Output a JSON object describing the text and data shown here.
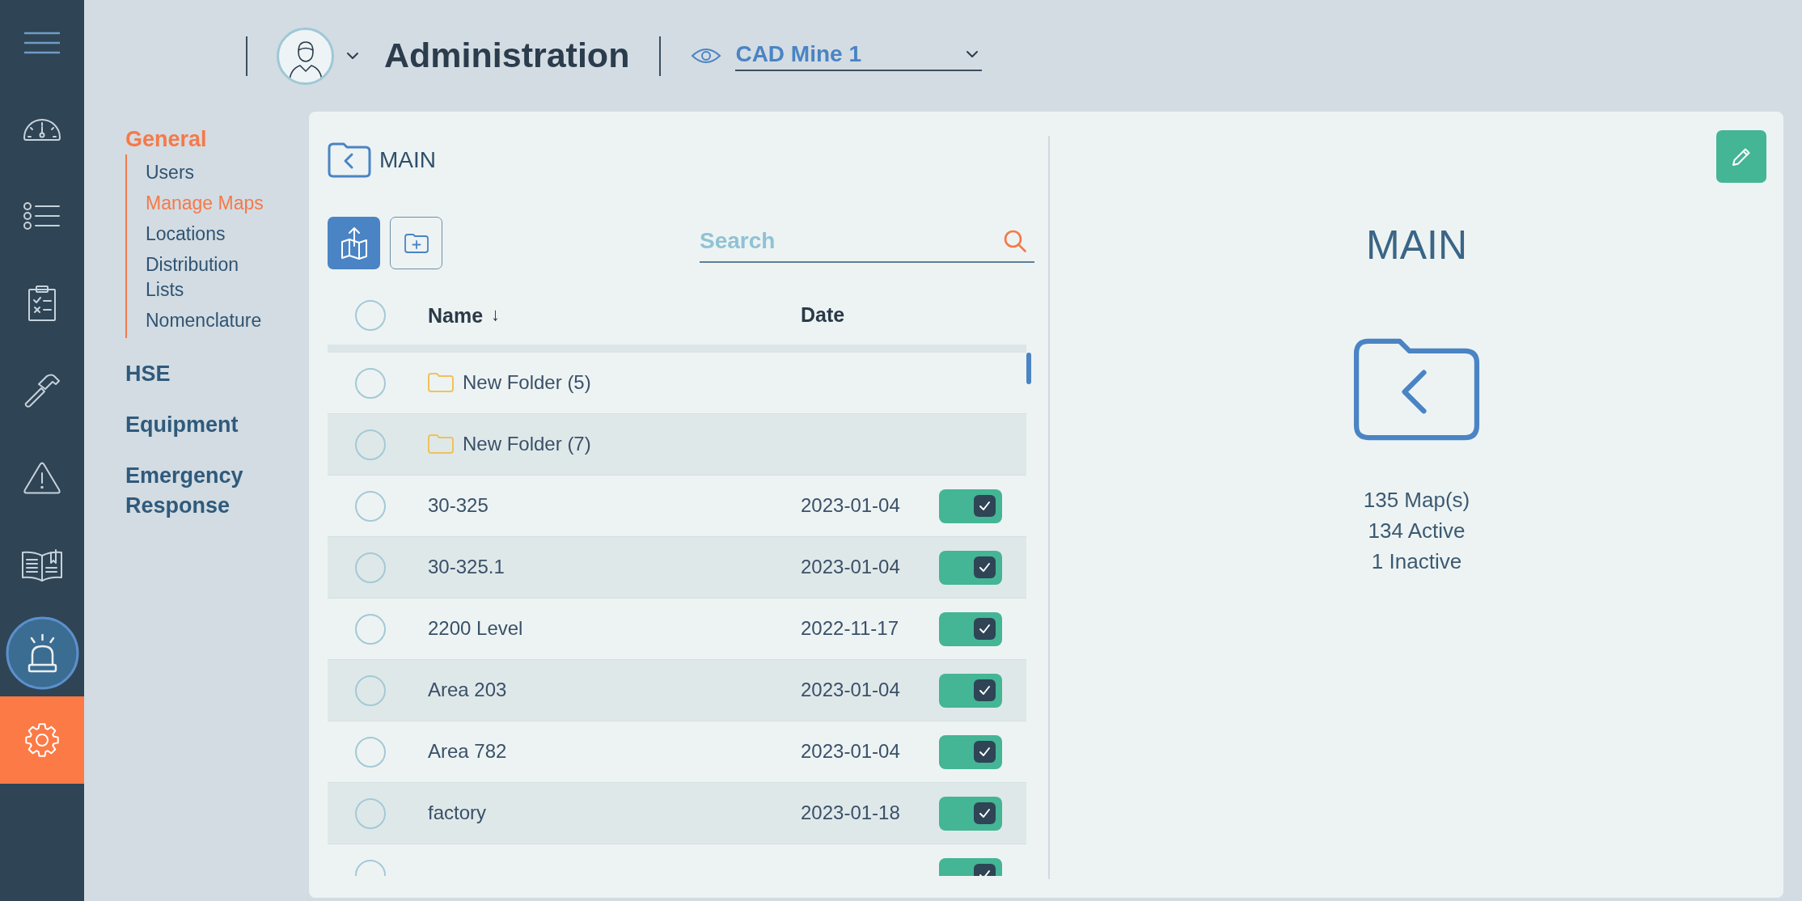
{
  "rail": {
    "items": [
      {
        "kind": "dashboard",
        "selected": false
      },
      {
        "kind": "list",
        "selected": false
      },
      {
        "kind": "checklist",
        "selected": false
      },
      {
        "kind": "hammer",
        "selected": false
      },
      {
        "kind": "warning",
        "selected": false
      },
      {
        "kind": "manual",
        "selected": false
      },
      {
        "kind": "alarm",
        "selected": false
      },
      {
        "kind": "settings",
        "selected": true
      }
    ]
  },
  "header": {
    "title": "Administration",
    "site": {
      "value": "CAD Mine 1"
    }
  },
  "nav": [
    {
      "label": "General",
      "selected": true,
      "children": [
        {
          "label": "Users",
          "selected": false
        },
        {
          "label": "Manage Maps",
          "selected": true
        },
        {
          "label": "Locations",
          "selected": false
        },
        {
          "label": "Distribution Lists",
          "selected": false
        },
        {
          "label": "Nomenclature",
          "selected": false
        }
      ]
    },
    {
      "label": "HSE",
      "selected": false
    },
    {
      "label": "Equipment",
      "selected": false
    },
    {
      "label": "Emergency Response",
      "selected": false
    }
  ],
  "folder": {
    "title": "MAIN",
    "search": {
      "placeholder": "Search"
    }
  },
  "table": {
    "select_all": {
      "checked": false
    },
    "columns": [
      {
        "label": "Name",
        "sort_mark": "↓"
      },
      {
        "label": "Date"
      }
    ],
    "rows": [
      {
        "kind": "folder",
        "name": "New Folder (5)",
        "checked": false
      },
      {
        "kind": "folder",
        "name": "New Folder (7)",
        "checked": false
      },
      {
        "kind": "map",
        "name": "30-325",
        "date": "2023-01-04",
        "active": true,
        "checked": false
      },
      {
        "kind": "map",
        "name": "30-325.1",
        "date": "2023-01-04",
        "active": true,
        "checked": false
      },
      {
        "kind": "map",
        "name": "2200 Level",
        "date": "2022-11-17",
        "active": true,
        "checked": false
      },
      {
        "kind": "map",
        "name": "Area 203",
        "date": "2023-01-04",
        "active": true,
        "checked": false
      },
      {
        "kind": "map",
        "name": "Area 782",
        "date": "2023-01-04",
        "active": true,
        "checked": false
      },
      {
        "kind": "map",
        "name": "factory",
        "date": "2023-01-18",
        "active": true,
        "checked": false
      },
      {
        "kind": "map",
        "active": true,
        "checked": false
      }
    ]
  },
  "details": {
    "title": "MAIN",
    "stats": [
      "135 Map(s)",
      "134 Active",
      "1 Inactive"
    ]
  }
}
